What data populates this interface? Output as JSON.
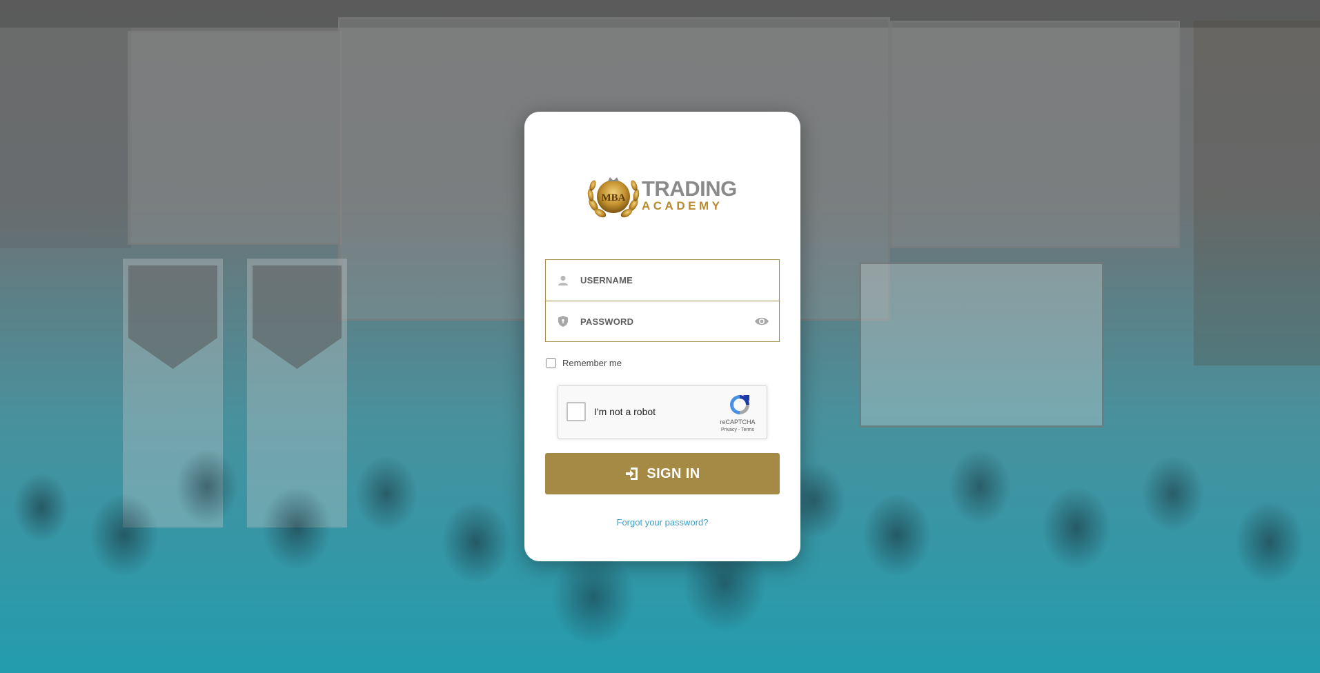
{
  "brand": {
    "logo_line1": "TRADING",
    "logo_line2": "ACADEMY",
    "emblem_text": "MBA",
    "gold_color": "#a48a44"
  },
  "form": {
    "username": {
      "placeholder": "USERNAME",
      "value": "",
      "icon": "user-icon"
    },
    "password": {
      "placeholder": "PASSWORD",
      "value": "",
      "icon": "shield-icon",
      "toggle_icon": "eye-icon"
    },
    "remember_label": "Remember me",
    "remember_checked": false
  },
  "recaptcha": {
    "label": "I'm not a robot",
    "brand": "reCAPTCHA",
    "links": "Privacy - Terms"
  },
  "actions": {
    "signin_label": "SIGN IN",
    "signin_icon": "sign-in-icon",
    "forgot_label": "Forgot your password?",
    "link_color": "#3b9fc8"
  }
}
